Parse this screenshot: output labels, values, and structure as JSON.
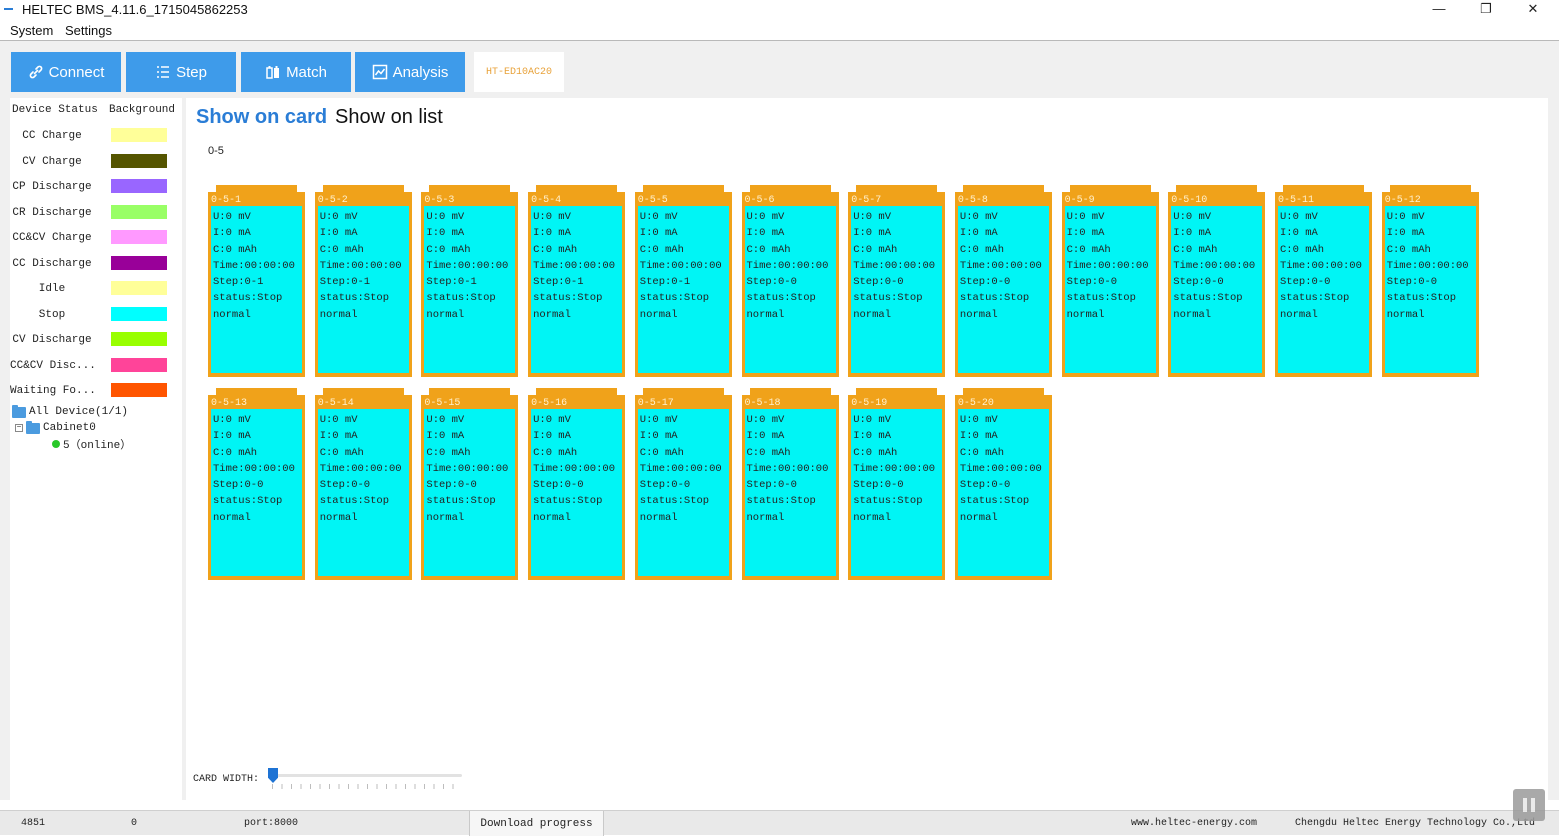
{
  "window": {
    "title": "HELTEC BMS_4.11.6_1715045862253",
    "minimize": "—",
    "maximize": "❐",
    "close": "✕"
  },
  "menu": {
    "items": [
      "System",
      "Settings"
    ]
  },
  "toolbar": {
    "connect": "Connect",
    "step": "Step",
    "match": "Match",
    "analysis": "Analysis",
    "device_tag": "HT-ED10AC20",
    "button_color": "#3e9bea"
  },
  "legend": {
    "header_status": "Device Status",
    "header_background": "Background",
    "items": [
      {
        "label": "CC Charge",
        "color": "#ffff99"
      },
      {
        "label": "CV Charge",
        "color": "#555500"
      },
      {
        "label": "CP Discharge",
        "color": "#9966ff"
      },
      {
        "label": "CR Discharge",
        "color": "#99ff66"
      },
      {
        "label": "CC&CV Charge",
        "color": "#ff99ff"
      },
      {
        "label": "CC Discharge",
        "color": "#990099"
      },
      {
        "label": "Idle",
        "color": "#ffff99"
      },
      {
        "label": "Stop",
        "color": "#00ffff"
      },
      {
        "label": "CV Discharge",
        "color": "#99ff00"
      },
      {
        "label": "CC&CV Disc...",
        "color": "#ff4499"
      },
      {
        "label": "Waiting Fo...",
        "color": "#ff5500"
      }
    ]
  },
  "tree": {
    "root": "All Device(1/1)",
    "cabinet": "Cabinet0",
    "device": "5（online）"
  },
  "view": {
    "card_tab": "Show on card",
    "list_tab": "Show on list",
    "group": "0-5"
  },
  "cards": [
    {
      "id": "0-5-1",
      "u": "U:0 mV",
      "i": "I:0 mA",
      "c": "C:0 mAh",
      "time": "Time:00:00:00",
      "step": "Step:0-1",
      "status": "status:Stop",
      "state": "normal"
    },
    {
      "id": "0-5-2",
      "u": "U:0 mV",
      "i": "I:0 mA",
      "c": "C:0 mAh",
      "time": "Time:00:00:00",
      "step": "Step:0-1",
      "status": "status:Stop",
      "state": "normal"
    },
    {
      "id": "0-5-3",
      "u": "U:0 mV",
      "i": "I:0 mA",
      "c": "C:0 mAh",
      "time": "Time:00:00:00",
      "step": "Step:0-1",
      "status": "status:Stop",
      "state": "normal"
    },
    {
      "id": "0-5-4",
      "u": "U:0 mV",
      "i": "I:0 mA",
      "c": "C:0 mAh",
      "time": "Time:00:00:00",
      "step": "Step:0-1",
      "status": "status:Stop",
      "state": "normal"
    },
    {
      "id": "0-5-5",
      "u": "U:0 mV",
      "i": "I:0 mA",
      "c": "C:0 mAh",
      "time": "Time:00:00:00",
      "step": "Step:0-1",
      "status": "status:Stop",
      "state": "normal"
    },
    {
      "id": "0-5-6",
      "u": "U:0 mV",
      "i": "I:0 mA",
      "c": "C:0 mAh",
      "time": "Time:00:00:00",
      "step": "Step:0-0",
      "status": "status:Stop",
      "state": "normal"
    },
    {
      "id": "0-5-7",
      "u": "U:0 mV",
      "i": "I:0 mA",
      "c": "C:0 mAh",
      "time": "Time:00:00:00",
      "step": "Step:0-0",
      "status": "status:Stop",
      "state": "normal"
    },
    {
      "id": "0-5-8",
      "u": "U:0 mV",
      "i": "I:0 mA",
      "c": "C:0 mAh",
      "time": "Time:00:00:00",
      "step": "Step:0-0",
      "status": "status:Stop",
      "state": "normal"
    },
    {
      "id": "0-5-9",
      "u": "U:0 mV",
      "i": "I:0 mA",
      "c": "C:0 mAh",
      "time": "Time:00:00:00",
      "step": "Step:0-0",
      "status": "status:Stop",
      "state": "normal"
    },
    {
      "id": "0-5-10",
      "u": "U:0 mV",
      "i": "I:0 mA",
      "c": "C:0 mAh",
      "time": "Time:00:00:00",
      "step": "Step:0-0",
      "status": "status:Stop",
      "state": "normal"
    },
    {
      "id": "0-5-11",
      "u": "U:0 mV",
      "i": "I:0 mA",
      "c": "C:0 mAh",
      "time": "Time:00:00:00",
      "step": "Step:0-0",
      "status": "status:Stop",
      "state": "normal"
    },
    {
      "id": "0-5-12",
      "u": "U:0 mV",
      "i": "I:0 mA",
      "c": "C:0 mAh",
      "time": "Time:00:00:00",
      "step": "Step:0-0",
      "status": "status:Stop",
      "state": "normal"
    },
    {
      "id": "0-5-13",
      "u": "U:0 mV",
      "i": "I:0 mA",
      "c": "C:0 mAh",
      "time": "Time:00:00:00",
      "step": "Step:0-0",
      "status": "status:Stop",
      "state": "normal"
    },
    {
      "id": "0-5-14",
      "u": "U:0 mV",
      "i": "I:0 mA",
      "c": "C:0 mAh",
      "time": "Time:00:00:00",
      "step": "Step:0-0",
      "status": "status:Stop",
      "state": "normal"
    },
    {
      "id": "0-5-15",
      "u": "U:0 mV",
      "i": "I:0 mA",
      "c": "C:0 mAh",
      "time": "Time:00:00:00",
      "step": "Step:0-0",
      "status": "status:Stop",
      "state": "normal"
    },
    {
      "id": "0-5-16",
      "u": "U:0 mV",
      "i": "I:0 mA",
      "c": "C:0 mAh",
      "time": "Time:00:00:00",
      "step": "Step:0-0",
      "status": "status:Stop",
      "state": "normal"
    },
    {
      "id": "0-5-17",
      "u": "U:0 mV",
      "i": "I:0 mA",
      "c": "C:0 mAh",
      "time": "Time:00:00:00",
      "step": "Step:0-0",
      "status": "status:Stop",
      "state": "normal"
    },
    {
      "id": "0-5-18",
      "u": "U:0 mV",
      "i": "I:0 mA",
      "c": "C:0 mAh",
      "time": "Time:00:00:00",
      "step": "Step:0-0",
      "status": "status:Stop",
      "state": "normal"
    },
    {
      "id": "0-5-19",
      "u": "U:0 mV",
      "i": "I:0 mA",
      "c": "C:0 mAh",
      "time": "Time:00:00:00",
      "step": "Step:0-0",
      "status": "status:Stop",
      "state": "normal"
    },
    {
      "id": "0-5-20",
      "u": "U:0 mV",
      "i": "I:0 mA",
      "c": "C:0 mAh",
      "time": "Time:00:00:00",
      "step": "Step:0-0",
      "status": "status:Stop",
      "state": "normal"
    }
  ],
  "card_colors": {
    "frame": "#f0a21a",
    "fill": "#00f5f5"
  },
  "slider": {
    "label": "CARD WIDTH:",
    "value_fraction": 0.0
  },
  "status": {
    "count": "4851",
    "value": "0",
    "port": "port:8000",
    "download": "Download progress",
    "website": "www.heltec-energy.com",
    "company": "Chengdu Heltec Energy Technology Co.,Ltd"
  }
}
